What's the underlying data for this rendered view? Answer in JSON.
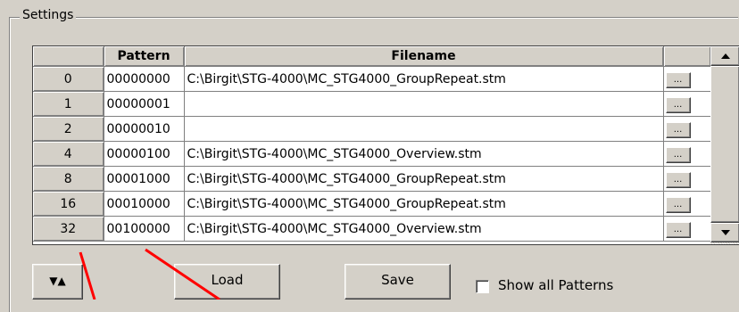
{
  "groupbox": {
    "title": "Settings"
  },
  "grid": {
    "headers": {
      "index": "",
      "pattern": "Pattern",
      "filename": "Filename",
      "browse": ""
    },
    "rows": [
      {
        "index": "0",
        "pattern": "00000000",
        "filename": "C:\\Birgit\\STG-4000\\MC_STG4000_GroupRepeat.stm",
        "browse": "..."
      },
      {
        "index": "1",
        "pattern": "00000001",
        "filename": "",
        "browse": "..."
      },
      {
        "index": "2",
        "pattern": "00000010",
        "filename": "",
        "browse": "..."
      },
      {
        "index": "4",
        "pattern": "00000100",
        "filename": "C:\\Birgit\\STG-4000\\MC_STG4000_Overview.stm",
        "browse": "..."
      },
      {
        "index": "8",
        "pattern": "00001000",
        "filename": "C:\\Birgit\\STG-4000\\MC_STG4000_GroupRepeat.stm",
        "browse": "..."
      },
      {
        "index": "16",
        "pattern": "00010000",
        "filename": "C:\\Birgit\\STG-4000\\MC_STG4000_GroupRepeat.stm",
        "browse": "..."
      },
      {
        "index": "32",
        "pattern": "00100000",
        "filename": "C:\\Birgit\\STG-4000\\MC_STG4000_Overview.stm",
        "browse": "..."
      }
    ]
  },
  "buttons": {
    "sort_label": "▼▲",
    "load_label": "Load",
    "save_label": "Save"
  },
  "checkbox": {
    "label": "Show all Patterns",
    "checked": false
  },
  "annotation_color": "#ff0000"
}
